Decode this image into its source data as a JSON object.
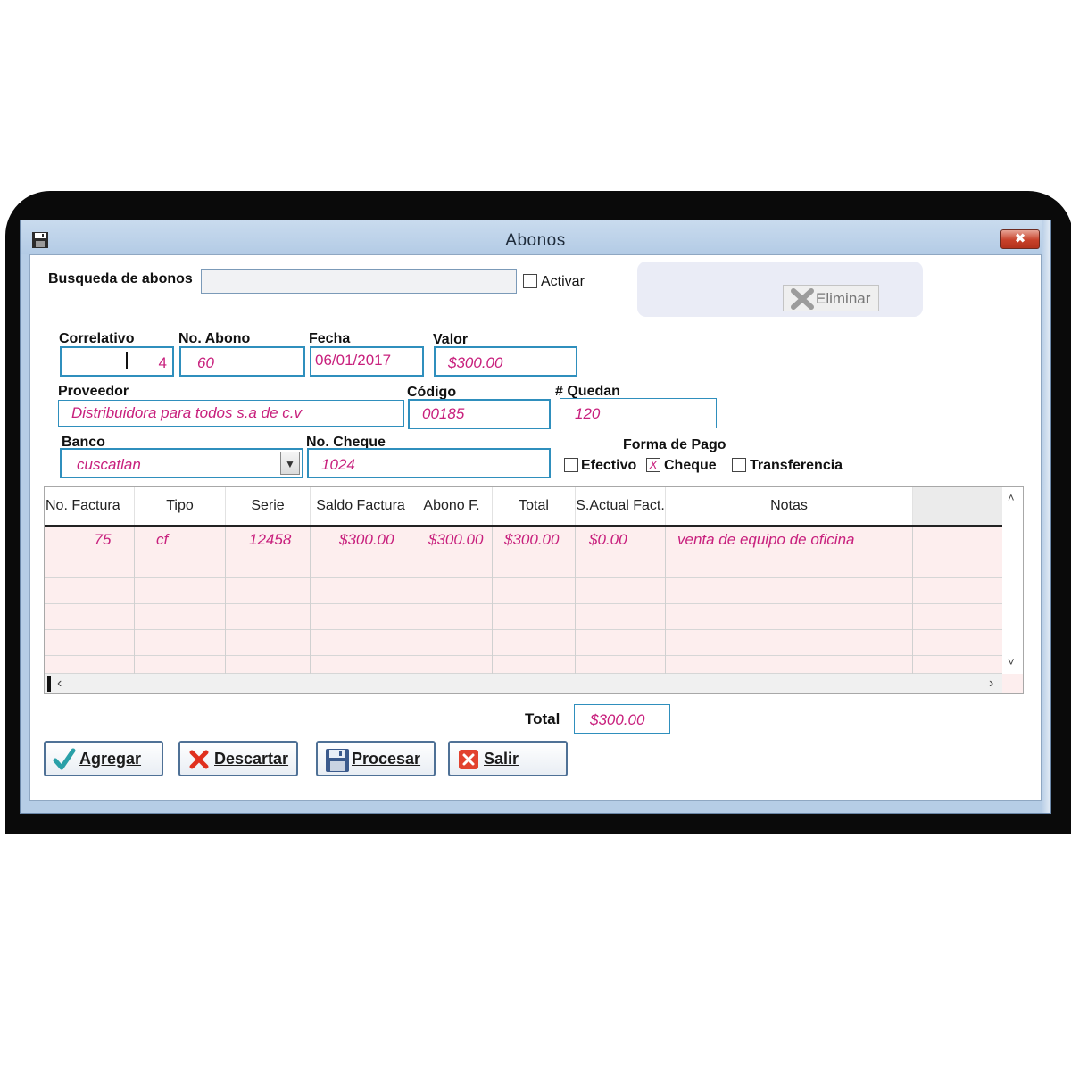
{
  "window": {
    "title": "Abonos",
    "close_symbol": "✖"
  },
  "icons": {
    "window_icon": "floppy-disk-icon",
    "close": "close-icon",
    "eliminar": "x-icon",
    "agregar": "checkmark-icon",
    "descartar": "red-x-icon",
    "procesar": "floppy-disk-icon",
    "salir": "close-square-icon"
  },
  "colors": {
    "accent_border": "#2f8fbd",
    "value_text": "#c8207d",
    "grid_row_bg": "#fdeeee"
  },
  "search": {
    "label": "Busqueda de abonos",
    "value": "",
    "activar_label": "Activar",
    "activar_checked": false
  },
  "eliminar": {
    "label": "Eliminar"
  },
  "form": {
    "correlativo": {
      "label": "Correlativo",
      "value": "4"
    },
    "no_abono": {
      "label": "No. Abono",
      "value": "60"
    },
    "fecha": {
      "label": "Fecha",
      "value": "06/01/2017"
    },
    "valor": {
      "label": "Valor",
      "value": "$300.00"
    },
    "proveedor": {
      "label": "Proveedor",
      "value": "Distribuidora para todos s.a de c.v"
    },
    "codigo": {
      "label": "Código",
      "value": "00185"
    },
    "quedan": {
      "label": "# Quedan",
      "value": "120"
    },
    "banco": {
      "label": "Banco",
      "value": "cuscatlan"
    },
    "no_cheque": {
      "label": "No. Cheque",
      "value": "1024"
    }
  },
  "forma_pago": {
    "label": "Forma de Pago",
    "options": [
      {
        "label": "Efectivo",
        "checked": false,
        "mark": ""
      },
      {
        "label": "Cheque",
        "checked": true,
        "mark": "X"
      },
      {
        "label": "Transferencia",
        "checked": false,
        "mark": ""
      }
    ]
  },
  "grid": {
    "columns": [
      "No. Factura",
      "Tipo",
      "Serie",
      "Saldo  Factura",
      "Abono F.",
      "Total",
      "S.Actual Fact.",
      "Notas"
    ],
    "rows": [
      [
        "75",
        "cf",
        "12458",
        "$300.00",
        "$300.00",
        "$300.00",
        "$0.00",
        "venta de equipo de oficina"
      ]
    ],
    "scroll": {
      "up": "˄",
      "down": "˅",
      "left": "‹",
      "right": "›"
    }
  },
  "total": {
    "label": "Total",
    "value": "$300.00"
  },
  "buttons": {
    "agregar": {
      "label": "Agregar"
    },
    "descartar": {
      "label": "Descartar"
    },
    "procesar": {
      "label": "Procesar"
    },
    "salir": {
      "label": "Salir"
    }
  }
}
